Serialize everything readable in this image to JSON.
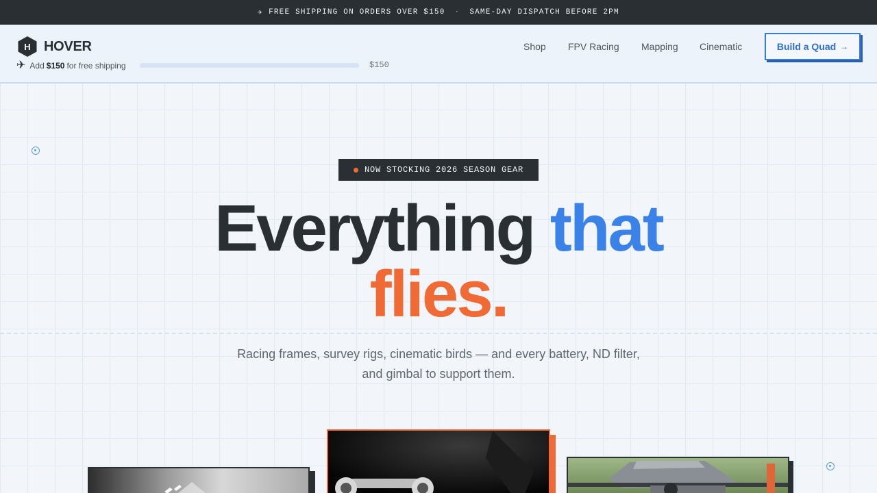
{
  "announcement": {
    "plane_icon": "plane-icon",
    "free_shipping": "FREE SHIPPING ON ORDERS OVER $150",
    "separator": "·",
    "dispatch": "SAME-DAY DISPATCH BEFORE 2PM"
  },
  "header": {
    "logo_mark": "H",
    "brand": "HOVER",
    "shipping": {
      "prefix": "Add",
      "amount": "$150",
      "suffix": "for free shipping",
      "progress": 0,
      "goal_label": "$150"
    },
    "nav": [
      "Shop",
      "FPV Racing",
      "Mapping",
      "Cinematic"
    ],
    "cta": {
      "label": "Build a Quad",
      "arrow": "→"
    }
  },
  "hero": {
    "badge": "NOW STOCKING 2026 SEASON GEAR",
    "headline": {
      "word1": "Everything",
      "word2": "that",
      "word3": "flies."
    },
    "subtitle": "Racing frames, survey rigs, cinematic birds — and every battery, ND filter, and gimbal to support them."
  },
  "colors": {
    "dark": "#2a2f33",
    "blue": "#3b82e8",
    "orange": "#f06a35",
    "background": "#f2f6fa"
  }
}
